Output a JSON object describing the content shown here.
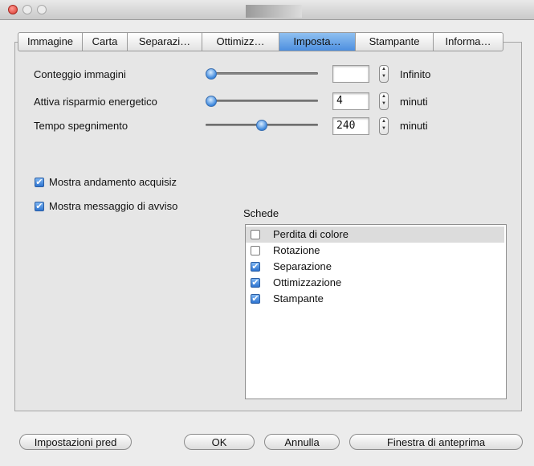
{
  "tabs": [
    "Immagine",
    "Carta",
    "Separazi…",
    "Ottimizz…",
    "Imposta…",
    "Stampante",
    "Informa…"
  ],
  "settings": {
    "image_count": {
      "label": "Conteggio immagini",
      "value": "",
      "unit": "Infinito",
      "level": 0.0
    },
    "energy_saving": {
      "label": "Attiva risparmio energetico",
      "value": "4",
      "unit": "minuti",
      "level": 0.0
    },
    "shutdown_time": {
      "label": "Tempo spegnimento",
      "value": "240",
      "unit": "minuti",
      "level": 0.5
    }
  },
  "options": {
    "show_progress": {
      "label": "Mostra andamento acquisiz",
      "checked": true
    },
    "show_warning": {
      "label": "Mostra messaggio di avviso",
      "checked": true
    }
  },
  "tabs_list": {
    "title": "Schede",
    "items": [
      {
        "label": "Perdita di colore",
        "checked": false,
        "selected": true
      },
      {
        "label": "Rotazione",
        "checked": false,
        "selected": false
      },
      {
        "label": "Separazione",
        "checked": true,
        "selected": false
      },
      {
        "label": "Ottimizzazione",
        "checked": true,
        "selected": false
      },
      {
        "label": "Stampante",
        "checked": true,
        "selected": false
      }
    ]
  },
  "buttons": {
    "defaults": "Impostazioni pred",
    "ok": "OK",
    "cancel": "Annulla",
    "preview": "Finestra di anteprima"
  },
  "colors": {
    "accent": "#3a86dc",
    "selected_tab": "#6aa8ea"
  },
  "icons": {
    "check": "✔",
    "stepper_up": "▲",
    "stepper_down": "▼"
  }
}
